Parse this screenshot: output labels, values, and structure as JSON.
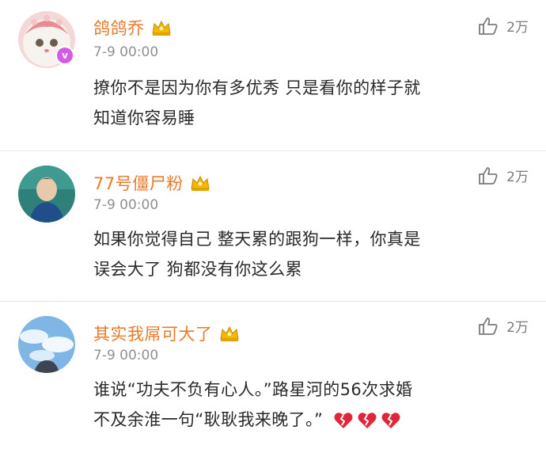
{
  "comments": [
    {
      "username": "鸽鸽乔",
      "time": "7-9 00:00",
      "text_line1": "撩你不是因为你有多优秀 只是看你的样子就",
      "text_line2": "知道你容易睡",
      "likes": "2万",
      "verified_symbol": "v"
    },
    {
      "username": "77号僵尸粉",
      "time": "7-9 00:00",
      "text_line1": "如果你觉得自己 整天累的跟狗一样，你真是",
      "text_line2": "误会大了 狗都没有你这么累",
      "likes": "2万"
    },
    {
      "username": "其实我屌可大了",
      "time": "7-9 00:00",
      "text_line1": "谁说“功夫不负有心人。”路星河的56次求婚",
      "text_line2": "不及余淮一句“耿耿我来晚了。”",
      "likes": "2万",
      "emoji": [
        "broken-heart",
        "broken-heart",
        "broken-heart"
      ]
    }
  ],
  "colors": {
    "username": "#e87a2a",
    "time": "#909090",
    "text": "#2a2a2a",
    "verified": "#d45be3",
    "heart": "#e0263a",
    "crown": "#f5b800"
  }
}
